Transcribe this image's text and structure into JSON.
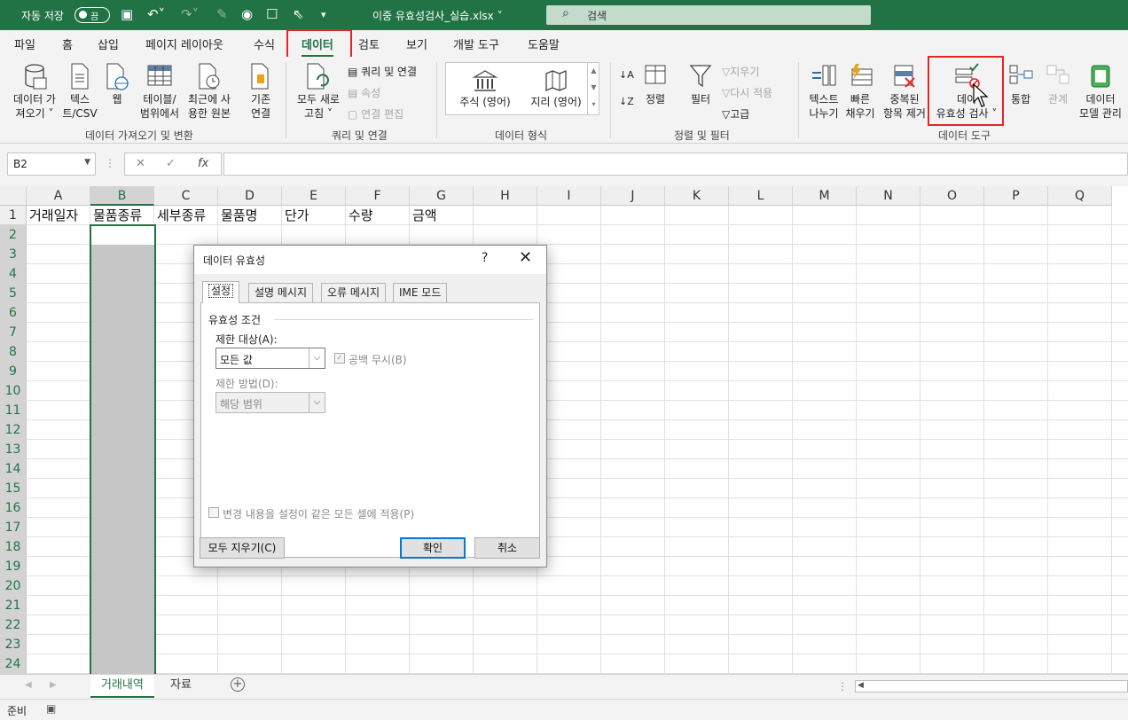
{
  "titlebar": {
    "autosave": "자동 저장",
    "toggle_state": "끔",
    "filename": "이중 유효성검사_실습.xlsx ˅",
    "search_placeholder": "검색",
    "accent": "#217346"
  },
  "ribbon_tabs": [
    "파일",
    "홈",
    "삽입",
    "페이지 레이아웃",
    "수식",
    "데이터",
    "검토",
    "보기",
    "개발 도구",
    "도움말"
  ],
  "ribbon": {
    "get_data": "데이터 가\n져오기 ˅",
    "text_csv": "텍스\n트/CSV",
    "web": "웹",
    "table_range": "테이블/\n범위에서",
    "recent_sources": "최근에 사\n용한 원본",
    "existing_conn": "기존\n연결",
    "group_get": "데이터 가져오기 및 변환",
    "refresh_all": "모두 새로\n고침 ˅",
    "queries_conn": "쿼리 및 연결",
    "properties": "속성",
    "edit_links": "연결 편집",
    "group_queries": "쿼리 및 연결",
    "stocks": "주식 (영어)",
    "geography": "지리 (영어)",
    "group_types": "데이터 형식",
    "sort": "정렬",
    "filter": "필터",
    "clear": "지우기",
    "reapply": "다시 적용",
    "advanced": "고급",
    "group_sort": "정렬 및 필터",
    "text_to_columns": "텍스트\n나누기",
    "flash_fill": "빠른\n채우기",
    "remove_dup": "중복된\n항목 제거",
    "data_validation": "데이\n유효성 검사 ˅",
    "consolidate": "통합",
    "relationships": "관계",
    "data_model": "데이터\n모델 관리",
    "group_tools": "데이터 도구"
  },
  "formula_bar": {
    "name_box": "B2",
    "fx": "fx",
    "formula": ""
  },
  "columns": [
    "A",
    "B",
    "C",
    "D",
    "E",
    "F",
    "G",
    "H",
    "I",
    "J",
    "K",
    "L",
    "M",
    "N",
    "O",
    "P",
    "Q"
  ],
  "rows": [
    "1",
    "2",
    "3",
    "4",
    "5",
    "6",
    "7",
    "8",
    "9",
    "10",
    "11",
    "12",
    "13",
    "14",
    "15",
    "16",
    "17",
    "18",
    "19",
    "20",
    "21",
    "22",
    "23",
    "24"
  ],
  "row1": [
    "거래일자",
    "물품종류",
    "세부종류",
    "물품명",
    "단가",
    "수량",
    "금액"
  ],
  "sheets": [
    "거래내역",
    "자료"
  ],
  "status": "준비",
  "dialog": {
    "title": "데이터 유효성",
    "help": "?",
    "tabs": [
      "설정",
      "설명 메시지",
      "오류 메시지",
      "IME 모드"
    ],
    "criteria_legend": "유효성 조건",
    "allow_label": "제한 대상(A):",
    "allow_value": "모든 값",
    "ignore_blank": "공백 무시(B)",
    "data_label": "제한 방법(D):",
    "data_value": "해당 범위",
    "apply_all": "변경 내용을 설정이 같은 모든 셀에 적용(P)",
    "clear_all": "모두 지우기(C)",
    "ok": "확인",
    "cancel": "취소"
  }
}
